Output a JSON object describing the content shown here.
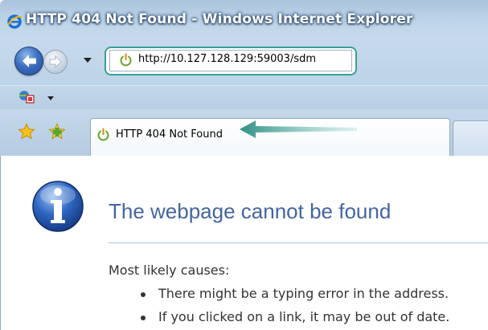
{
  "window": {
    "title": "HTTP 404 Not Found - Windows Internet Explorer",
    "app_icon": "internet-explorer-icon"
  },
  "navigation": {
    "back_icon": "back-arrow-icon",
    "forward_icon": "forward-arrow-icon",
    "history_dropdown_icon": "chevron-down-icon",
    "address": "http://10.127.128.129:59003/sdm",
    "site_icon": "power-icon"
  },
  "toolbar": {
    "feeds_icon": "feeds-icon",
    "dropdown_icon": "chevron-down-icon"
  },
  "tabs": {
    "favorites_icon": "star-icon",
    "add_favorites_icon": "add-favorite-icon",
    "active_tab": {
      "label": "HTTP 404 Not Found",
      "icon": "power-icon"
    },
    "annotation_arrow_color": "#3a9a8e"
  },
  "content": {
    "icon": "info-icon",
    "heading": "The webpage cannot be found",
    "causes_label": "Most likely causes:",
    "causes": [
      "There might be a typing error in the address.",
      "If you clicked on a link, it may be out of date."
    ]
  },
  "colors": {
    "chrome": "#bcd3e8",
    "heading": "#4465a2",
    "highlight": "#3b9e93"
  }
}
